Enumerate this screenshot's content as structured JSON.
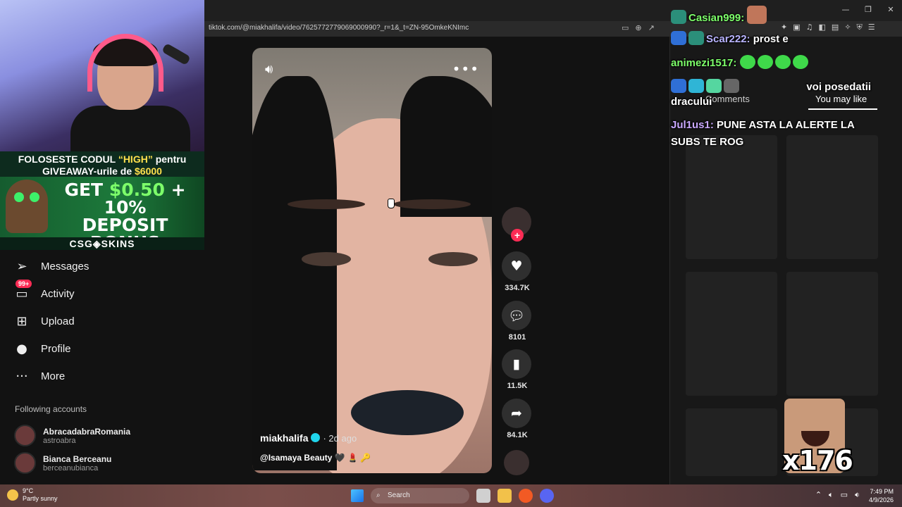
{
  "browser": {
    "url": "tiktok.com/@miakhalifa/video/7625772779069000990?_r=1&_t=ZN-95OmkeKNImc"
  },
  "overlay": {
    "promo_line1_a": "FOLOSESTE CODUL ",
    "promo_code": "“HIGH”",
    "promo_line1_b": " pentru",
    "promo_line2_a": "GIVEAWAY-urile de ",
    "promo_amount": "$6000",
    "bonus_line1_a": "GET ",
    "bonus_line1_amt": "$0.50",
    "bonus_line1_b": " + 10%",
    "bonus_line2": "DEPOSIT BONUS",
    "brand": "CSG◈SKINS"
  },
  "nav": {
    "items": [
      {
        "label": "Messages",
        "icon": "paper-plane-icon"
      },
      {
        "label": "Activity",
        "icon": "inbox-icon",
        "badge": "99+"
      },
      {
        "label": "Upload",
        "icon": "plus-square-icon"
      },
      {
        "label": "Profile",
        "icon": "profile-avatar-icon"
      },
      {
        "label": "More",
        "icon": "more-dots-icon"
      }
    ],
    "following_title": "Following accounts",
    "accounts": [
      {
        "name": "AbracadabraRomania",
        "handle": "astroabra"
      },
      {
        "name": "Bianca Berceanu",
        "handle": "berceanubianca"
      }
    ]
  },
  "video": {
    "author": "miakhalifa",
    "time": "· 2d ago",
    "caption": "@Isamaya Beauty 🖤 💄 🔑",
    "likes": "334.7K",
    "comments": "8101",
    "saves": "11.5K",
    "shares": "84.1K"
  },
  "right_panel": {
    "tab_comments": "Comments",
    "tab_you_may_like": "You may like"
  },
  "chat": [
    {
      "user": "Casian999:",
      "text": "",
      "color": "#7dff6a"
    },
    {
      "user": "Scar222:",
      "text": "prost e",
      "color": "#b8b3ff"
    },
    {
      "user": "animezi1517:",
      "text": "",
      "color": "#7dff6a"
    },
    {
      "user": "",
      "text": "voi posedatii",
      "color": "#ffffff"
    },
    {
      "user": "",
      "text": "dracului",
      "color": "#ffffff"
    },
    {
      "user": "Jul1us1:",
      "text": "PUNE ASTA LA ALERTE LA",
      "color": "#c9a8ff"
    },
    {
      "user": "",
      "text": "SUBS TE ROG",
      "color": "#ffffff"
    }
  ],
  "emote_count": "x176",
  "taskbar": {
    "temp": "9°C",
    "weather": "Partly sunny",
    "search": "Search",
    "time": "7:49 PM",
    "date": "4/9/2026"
  }
}
